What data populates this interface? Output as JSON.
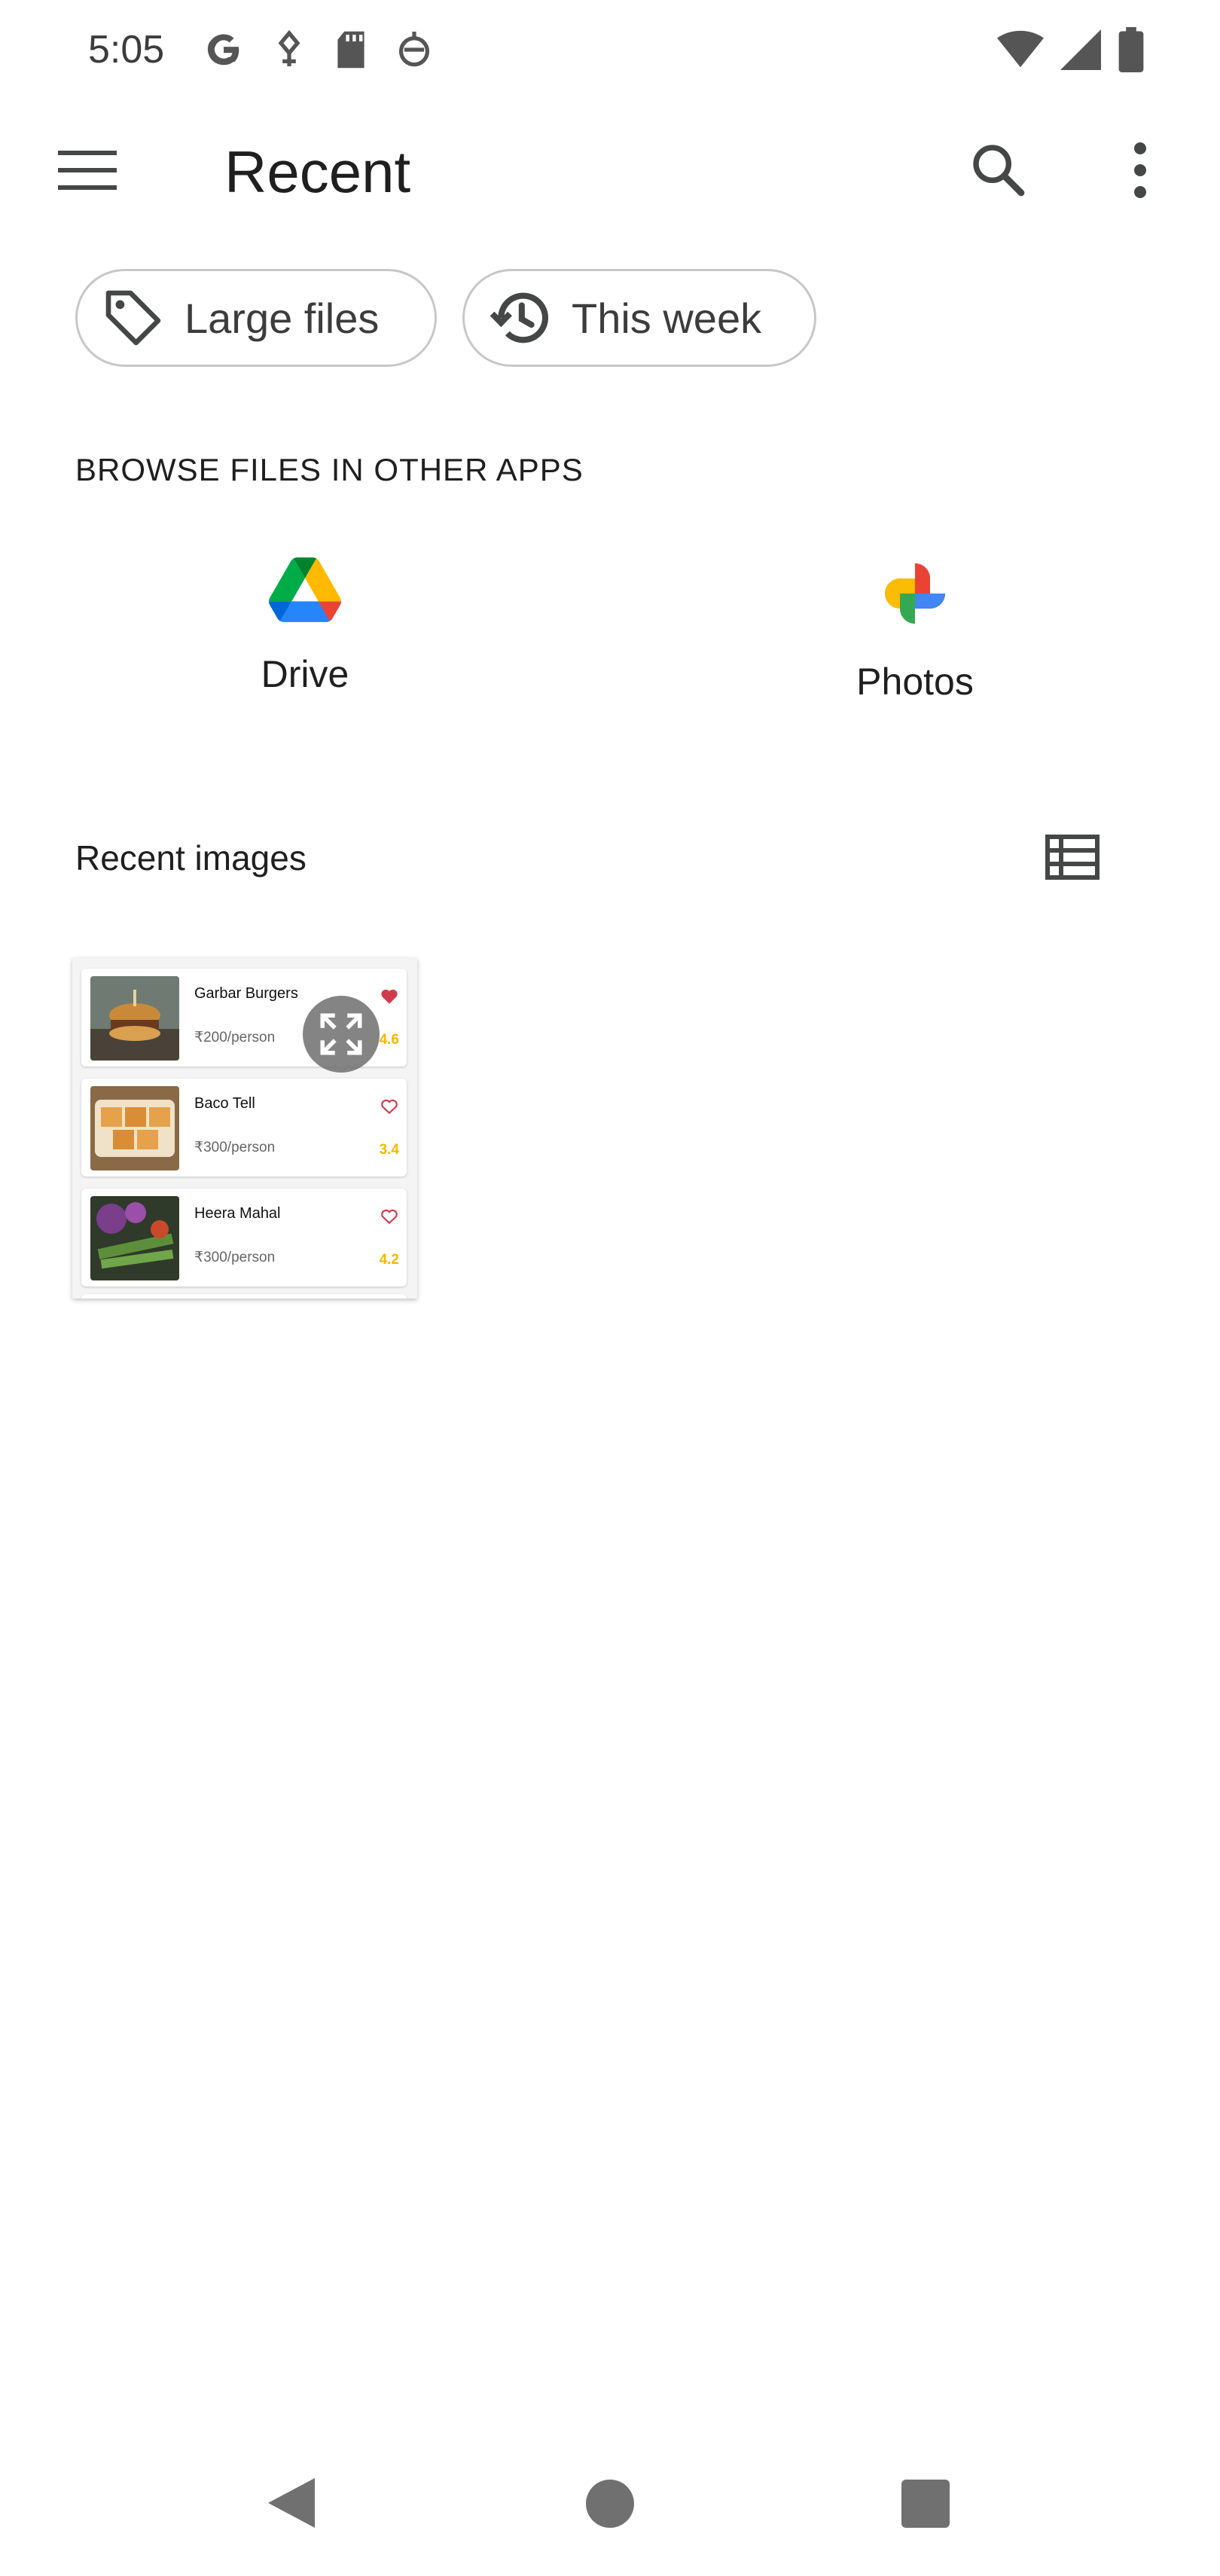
{
  "status_bar": {
    "time": "5:05",
    "left_icons": [
      "google-icon",
      "weather-alert-icon",
      "sd-card-icon",
      "notification-robot-icon"
    ],
    "right_icons": [
      "wifi-icon",
      "signal-icon",
      "battery-icon"
    ]
  },
  "app_bar": {
    "title": "Recent",
    "icons": [
      "menu-icon",
      "search-icon",
      "more-vert-icon"
    ]
  },
  "chips": [
    {
      "label": "Large files",
      "icon": "tag-icon"
    },
    {
      "label": "This week",
      "icon": "history-icon"
    }
  ],
  "browse_section": {
    "heading": "BROWSE FILES IN OTHER APPS",
    "apps": [
      {
        "label": "Drive",
        "icon": "google-drive-icon"
      },
      {
        "label": "Photos",
        "icon": "google-photos-icon"
      }
    ]
  },
  "recent_images": {
    "heading": "Recent images",
    "view_icon": "list-view-icon",
    "thumbnail": {
      "cards": [
        {
          "name": "Garbar Burgers",
          "price": "₹200/person",
          "rating": "4.6",
          "favorited": true
        },
        {
          "name": "Baco Tell",
          "price": "₹300/person",
          "rating": "3.4",
          "favorited": false
        },
        {
          "name": "Heera Mahal",
          "price": "₹300/person",
          "rating": "4.2",
          "favorited": false
        }
      ],
      "expand_icon": "expand-icon"
    }
  },
  "nav_bar": {
    "icons": [
      "back-icon",
      "home-icon",
      "recents-icon"
    ]
  },
  "colors": {
    "accent_heart": "#d23b4e",
    "rating": "#f5b800",
    "chip_border": "#c7c7c7",
    "icon_gray": "#444746"
  }
}
